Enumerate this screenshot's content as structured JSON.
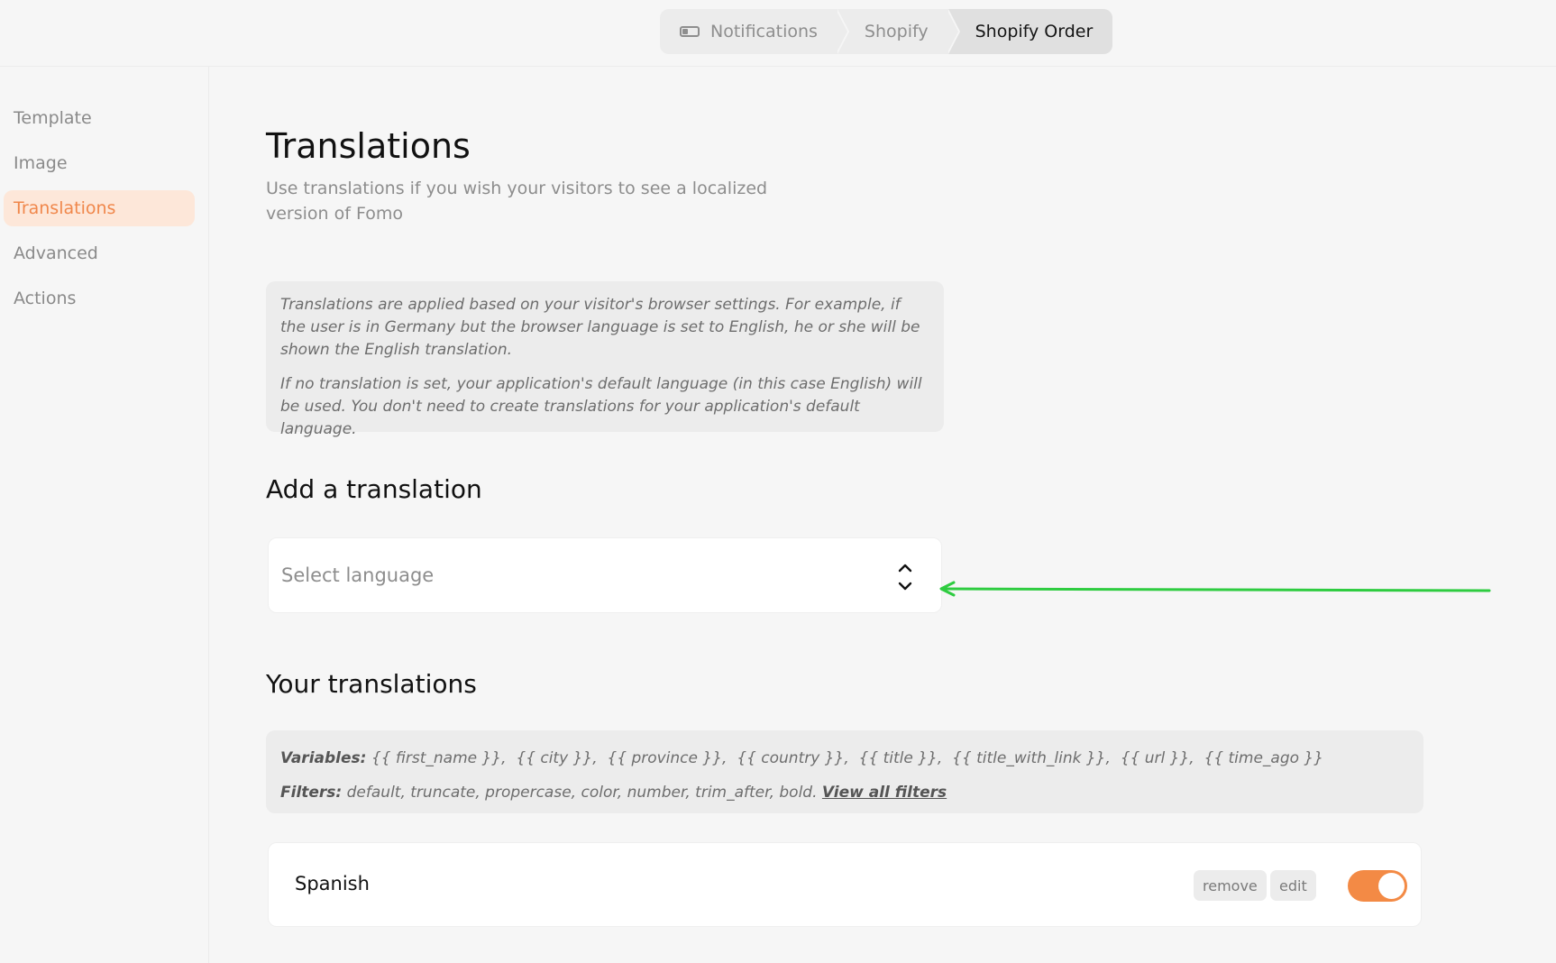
{
  "breadcrumb": {
    "items": [
      {
        "label": "Notifications",
        "icon": "toggle-icon"
      },
      {
        "label": "Shopify"
      },
      {
        "label": "Shopify Order"
      }
    ]
  },
  "sidebar": {
    "items": [
      {
        "label": "Template"
      },
      {
        "label": "Image"
      },
      {
        "label": "Translations",
        "active": true
      },
      {
        "label": "Advanced"
      },
      {
        "label": "Actions"
      }
    ]
  },
  "main": {
    "title": "Translations",
    "subtitle": "Use translations if you wish your visitors to see a localized version of Fomo",
    "info": {
      "p1": "Translations are applied based on your visitor's browser settings. For example, if the user is in Germany but the browser language is set to English, he or she will be shown the English translation.",
      "p2": "If no translation is set, your application's default language (in this case English) will be used. You don't need to create translations for your application's default language."
    },
    "add_heading": "Add a translation",
    "select_placeholder": "Select language",
    "your_heading": "Your translations",
    "variables_label": "Variables:",
    "variables_text": "{{ first_name }},  {{ city }},  {{ province }},  {{ country }},  {{ title }},  {{ title_with_link }},  {{ url }},  {{ time_ago }}",
    "filters_label": "Filters:",
    "filters_text": "default, truncate, propercase, color, number, trim_after, bold.",
    "filters_link": "View all filters",
    "translations": [
      {
        "language": "Spanish",
        "remove_label": "remove",
        "edit_label": "edit",
        "enabled": true
      }
    ]
  },
  "colors": {
    "accent": "#f38a45",
    "active_bg": "#fde7d9",
    "annotation_arrow": "#2ecc40"
  }
}
